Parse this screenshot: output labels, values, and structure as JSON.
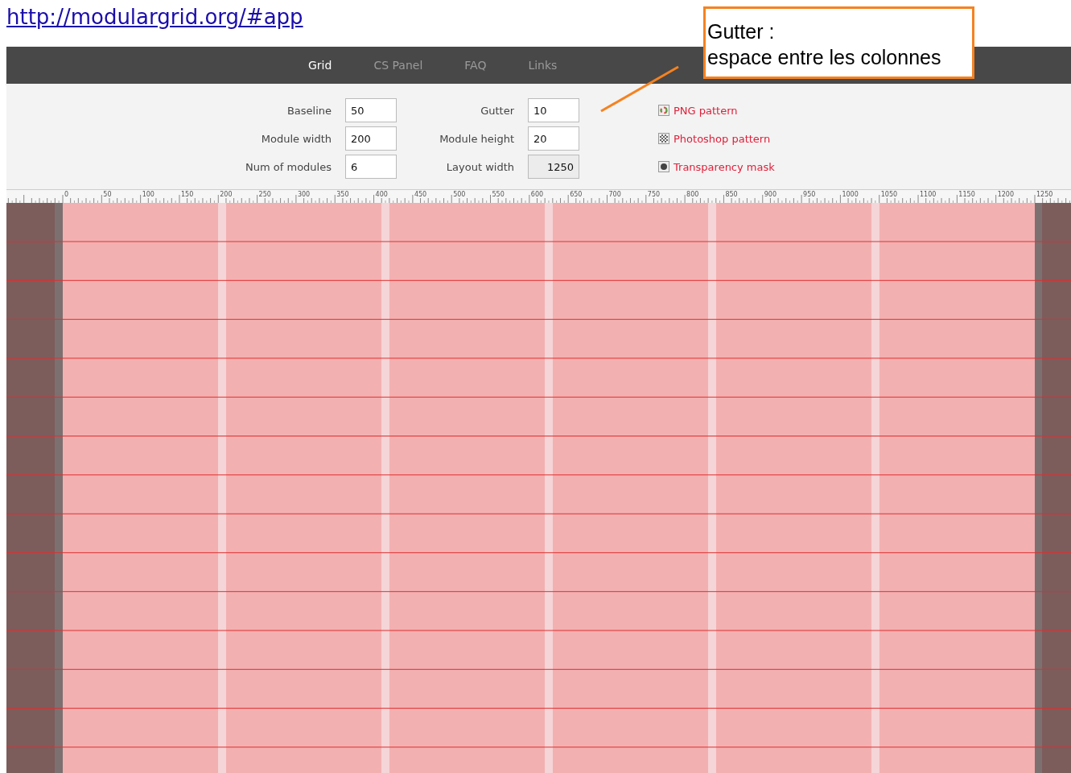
{
  "url": "http://modulargrid.org/#app",
  "nav": [
    {
      "label": "Grid",
      "selected": true
    },
    {
      "label": "CS Panel",
      "selected": false
    },
    {
      "label": "FAQ",
      "selected": false
    },
    {
      "label": "Links",
      "selected": false
    }
  ],
  "fields": [
    {
      "label": "Baseline",
      "value": "50",
      "disabled": false
    },
    {
      "label": "Gutter",
      "value": "10",
      "disabled": false
    },
    {
      "label": "Module width",
      "value": "200",
      "disabled": false
    },
    {
      "label": "Module height",
      "value": "20",
      "disabled": false
    },
    {
      "label": "Num of modules",
      "value": "6",
      "disabled": false
    },
    {
      "label": "Layout width",
      "value": "1250",
      "disabled": true
    }
  ],
  "links": [
    {
      "label": "PNG pattern",
      "kind": "png"
    },
    {
      "label": "Photoshop pattern",
      "kind": "photoshop"
    },
    {
      "label": "Transparency mask",
      "kind": "mask"
    }
  ],
  "ruler": {
    "labels": [
      "0",
      "50",
      "100",
      "150",
      "200",
      "250",
      "300",
      "350",
      "400",
      "450",
      "500",
      "550",
      "600",
      "650",
      "700",
      "750",
      "800",
      "850",
      "900",
      "950",
      "1000",
      "1050",
      "1100",
      "1150",
      "1200",
      "1250"
    ]
  },
  "callout": {
    "lines": [
      "Gutter :",
      "espace entre les colonnes"
    ]
  }
}
